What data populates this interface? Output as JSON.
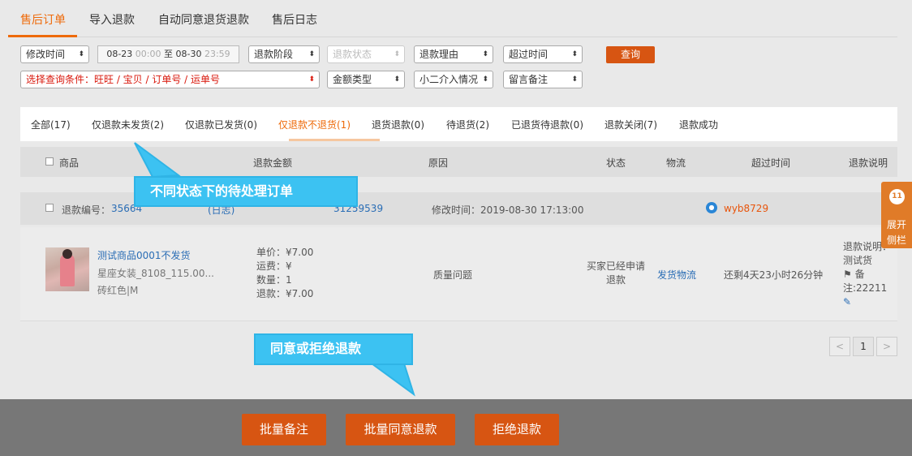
{
  "top_tabs": [
    {
      "label": "售后订单",
      "active": true
    },
    {
      "label": "导入退款",
      "active": false
    },
    {
      "label": "自动同意退货退款",
      "active": false
    },
    {
      "label": "售后日志",
      "active": false
    }
  ],
  "filters": {
    "time_type": "修改时间",
    "date_start": "08-23",
    "date_start_time": "00:00",
    "date_to": "至",
    "date_end": "08-30",
    "date_end_time": "23:59",
    "refund_stage": "退款阶段",
    "refund_status": "退款状态",
    "refund_reason": "退款理由",
    "overdue_time": "超过时间",
    "query_label": "查询",
    "query_condition": "选择查询条件：旺旺 / 宝贝 / 订单号 / 运单号",
    "amount_type": "金额类型",
    "xiaoer": "小二介入情况",
    "remark": "留言备注"
  },
  "status_tabs": [
    {
      "label": "全部(17)"
    },
    {
      "label": "仅退款未发货(2)"
    },
    {
      "label": "仅退款已发货(0)"
    },
    {
      "label": "仅退款不退货(1)",
      "active": true
    },
    {
      "label": "退货退款(0)"
    },
    {
      "label": "待退货(2)"
    },
    {
      "label": "已退货待退款(0)"
    },
    {
      "label": "退款关闭(7)"
    },
    {
      "label": "退款成功"
    }
  ],
  "table_headers": {
    "product": "商品",
    "amount": "退款金额",
    "reason": "原因",
    "status": "状态",
    "logistics": "物流",
    "overdue": "超过时间",
    "note": "退款说明"
  },
  "order": {
    "refund_no_label": "退款编号：",
    "refund_no": "35664",
    "refund_no_tail": "(日志)",
    "order_no": "31259539",
    "modified": "修改时间：2019-08-30 17:13:00",
    "buyer": "wyb8729",
    "product_name": "测试商品0001不发货",
    "product_shop": "星座女装_8108_115.00...",
    "product_sku": "砖红色|M",
    "price": "单价：¥7.00",
    "freight": "运费：¥",
    "quantity": "数量：1",
    "refund_amount": "退款：¥7.00",
    "reason": "质量问题",
    "status_line1": "买家已经申请",
    "status_line2": "退款",
    "logistics": "发货物流",
    "overdue": "还剩4天23小时26分钟",
    "note_line1": "退款说明：",
    "note_line2": "测试货",
    "note_line3": "备",
    "note_line4": "注:22211"
  },
  "pager": {
    "prev": "<",
    "current": "1",
    "next": ">"
  },
  "side_panel": {
    "line1": "展开",
    "line2": "侧栏"
  },
  "bottom_buttons": {
    "batch_remark": "批量备注",
    "batch_agree": "批量同意退款",
    "reject": "拒绝退款"
  },
  "callouts": {
    "pending_orders": "不同状态下的待处理订单",
    "agree_or_reject": "同意或拒绝退款"
  }
}
